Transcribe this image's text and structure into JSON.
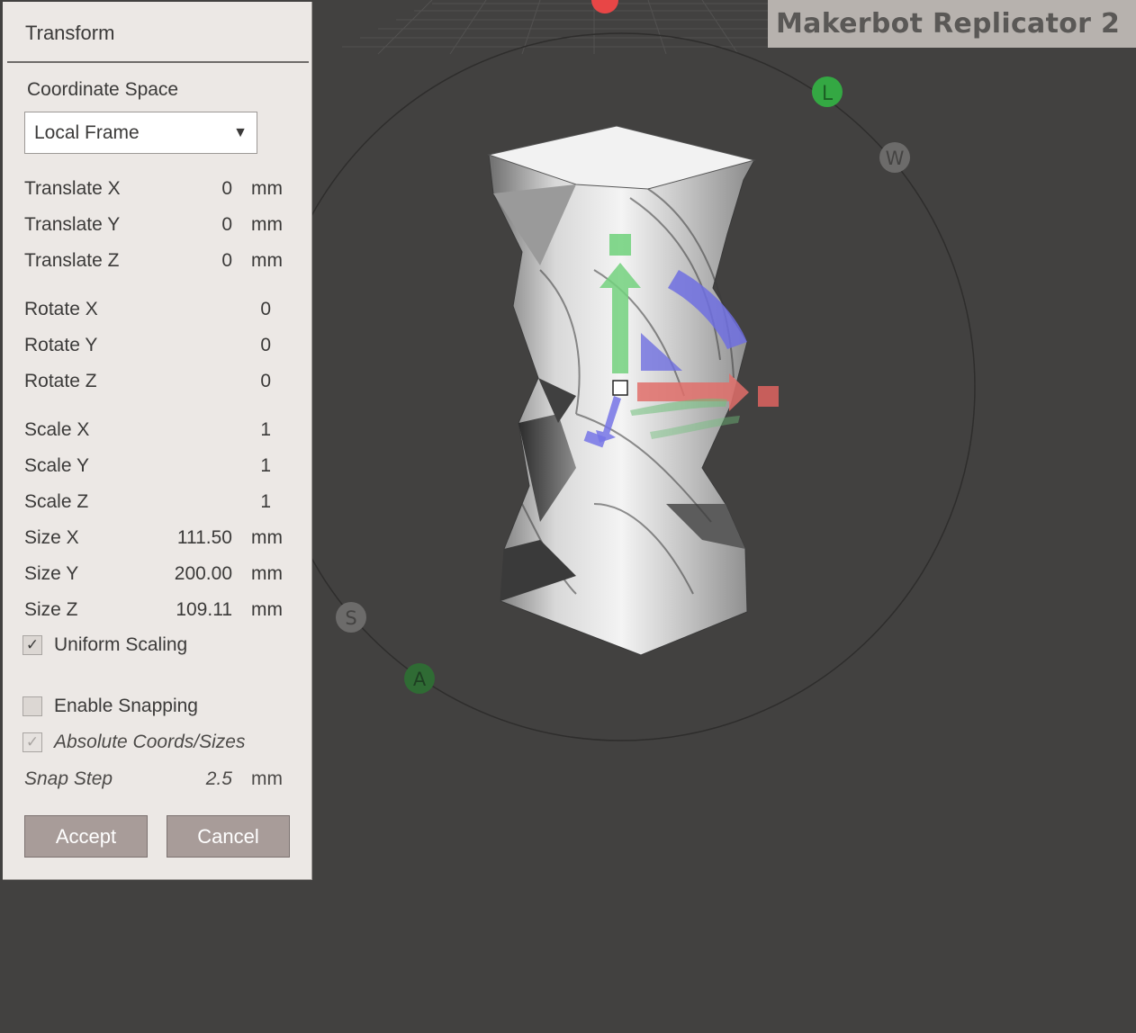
{
  "viewport": {
    "printer_name": "Makerbot Replicator 2",
    "compass": {
      "north": "L",
      "east": "W",
      "south": "A",
      "west": "S"
    }
  },
  "panel": {
    "title": "Transform",
    "coordinate_space": {
      "label": "Coordinate Space",
      "value": "Local Frame"
    },
    "translate": [
      {
        "label": "Translate X",
        "value": "0",
        "unit": "mm"
      },
      {
        "label": "Translate Y",
        "value": "0",
        "unit": "mm"
      },
      {
        "label": "Translate Z",
        "value": "0",
        "unit": "mm"
      }
    ],
    "rotate": [
      {
        "label": "Rotate X",
        "value": "0"
      },
      {
        "label": "Rotate Y",
        "value": "0"
      },
      {
        "label": "Rotate Z",
        "value": "0"
      }
    ],
    "scale": [
      {
        "label": "Scale X",
        "value": "1"
      },
      {
        "label": "Scale Y",
        "value": "1"
      },
      {
        "label": "Scale Z",
        "value": "1"
      }
    ],
    "size": [
      {
        "label": "Size X",
        "value": "111.50",
        "unit": "mm"
      },
      {
        "label": "Size Y",
        "value": "200.00",
        "unit": "mm"
      },
      {
        "label": "Size Z",
        "value": "109.11",
        "unit": "mm"
      }
    ],
    "uniform_scaling": {
      "label": "Uniform Scaling",
      "checked": true
    },
    "enable_snapping": {
      "label": "Enable Snapping",
      "checked": false
    },
    "absolute_coords": {
      "label": "Absolute Coords/Sizes",
      "checked": true
    },
    "snap_step": {
      "label": "Snap Step",
      "value": "2.5",
      "unit": "mm"
    },
    "accept_label": "Accept",
    "cancel_label": "Cancel",
    "check_glyph": "✓",
    "dropdown_glyph": "▼"
  },
  "colors": {
    "background": "#424140",
    "panel": "#ece8e5",
    "button": "#a89c99",
    "axis_x": "#d9635f",
    "axis_y": "#6fd17a",
    "axis_z": "#6a6ce0"
  }
}
